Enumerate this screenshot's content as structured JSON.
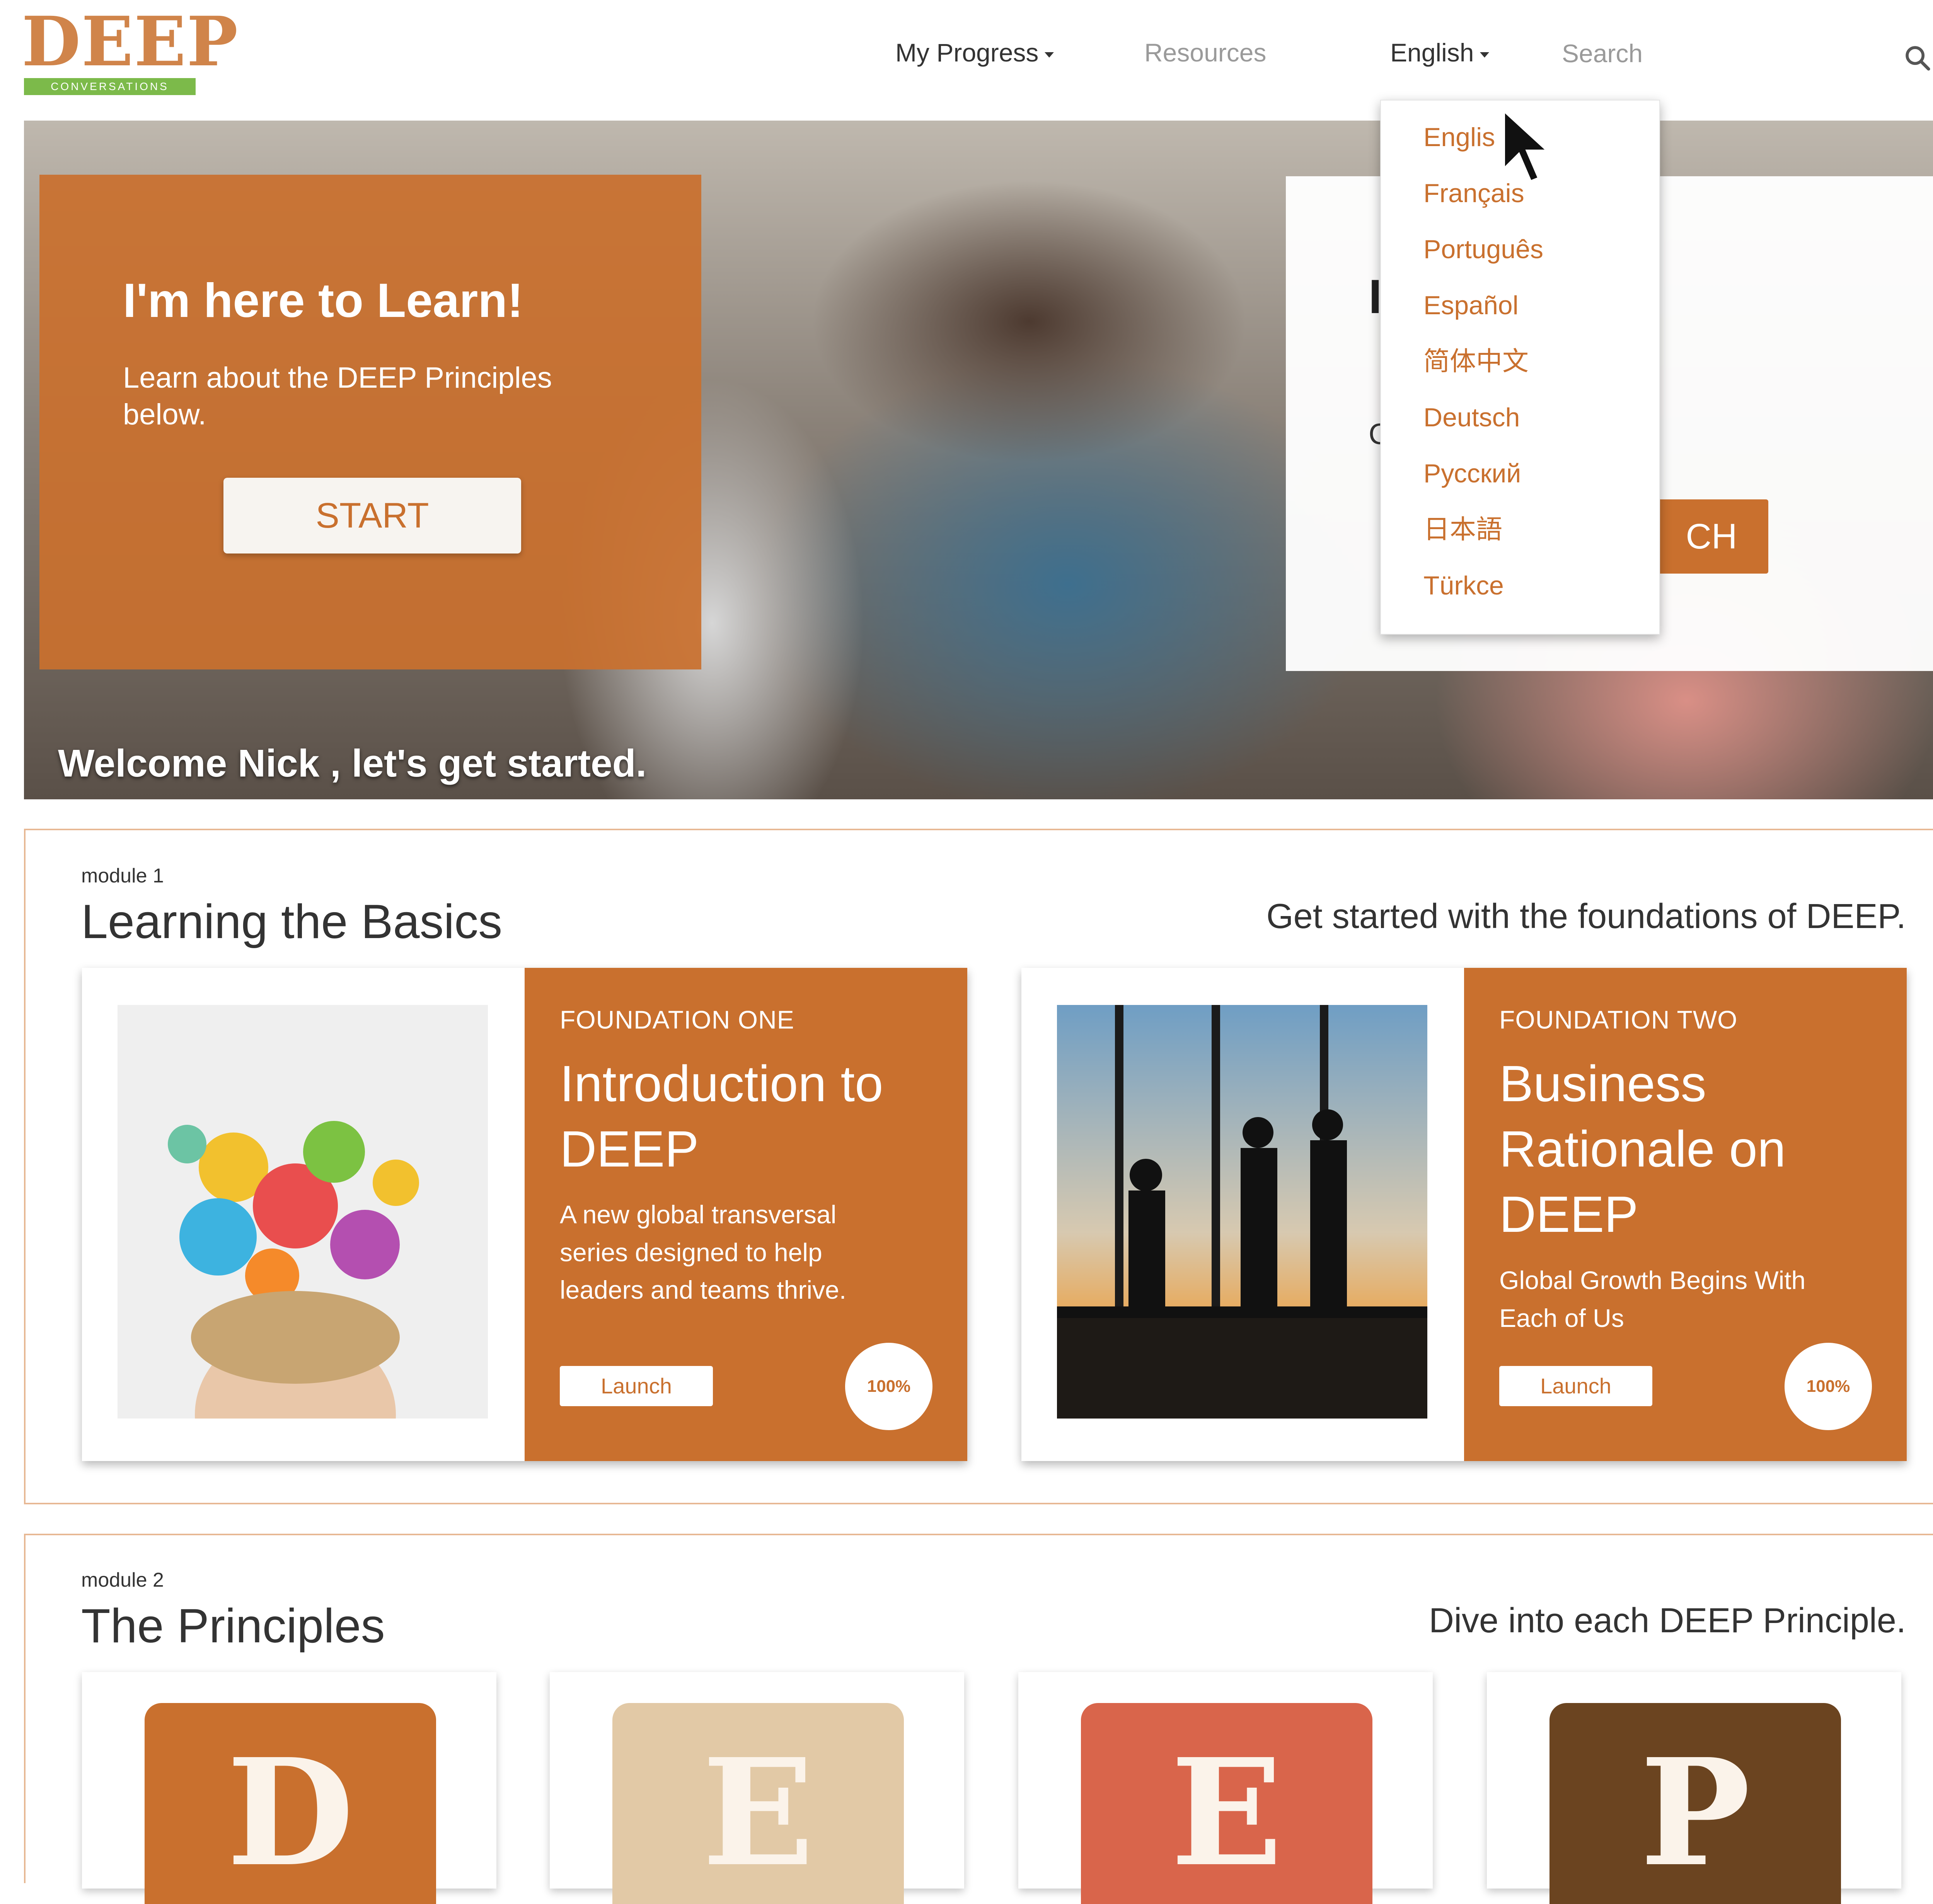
{
  "header": {
    "logo": {
      "word": "DEEP",
      "sub": "CONVERSATIONS"
    },
    "nav": {
      "my_progress": "My Progress",
      "resources": "Resources",
      "language": "English",
      "search_placeholder": "Search"
    }
  },
  "language_menu": {
    "items": [
      "Englis",
      "Français",
      "Português",
      "Español",
      "简体中文",
      "Deutsch",
      "Русский",
      "日本語",
      "Türkce"
    ]
  },
  "hero": {
    "learn": {
      "title": "I'm here to Learn!",
      "text": "Learn about the DEEP Principles below.",
      "button": "START"
    },
    "find": {
      "title": "I ind I",
      "text": "C and Videos.",
      "button": "CH"
    },
    "welcome": "Welcome Nick , let's get started."
  },
  "module1": {
    "label": "module 1",
    "title": "Learning the Basics",
    "tagline": "Get started with the foundations of DEEP.",
    "cards": [
      {
        "kicker": "FOUNDATION ONE",
        "title": "Introduction to DEEP",
        "desc": "A new global transversal series designed to help leaders and teams thrive.",
        "button": "Launch",
        "progress": "100%"
      },
      {
        "kicker": "FOUNDATION TWO",
        "title": "Business Rationale on DEEP",
        "desc": "Global Growth Begins With Each of Us",
        "button": "Launch",
        "progress": "100%"
      }
    ]
  },
  "module2": {
    "label": "module 2",
    "title": "The Principles",
    "tagline": "Dive into each DEEP Principle.",
    "principles": [
      {
        "letter": "D",
        "color": "#c9702e"
      },
      {
        "letter": "E",
        "color": "#e2c9a6"
      },
      {
        "letter": "E",
        "color": "#d9654b"
      },
      {
        "letter": "P",
        "color": "#6b4420"
      }
    ]
  },
  "colors": {
    "accent": "#c9702e",
    "logo_green": "#7cba4a",
    "border": "#e7b894"
  }
}
